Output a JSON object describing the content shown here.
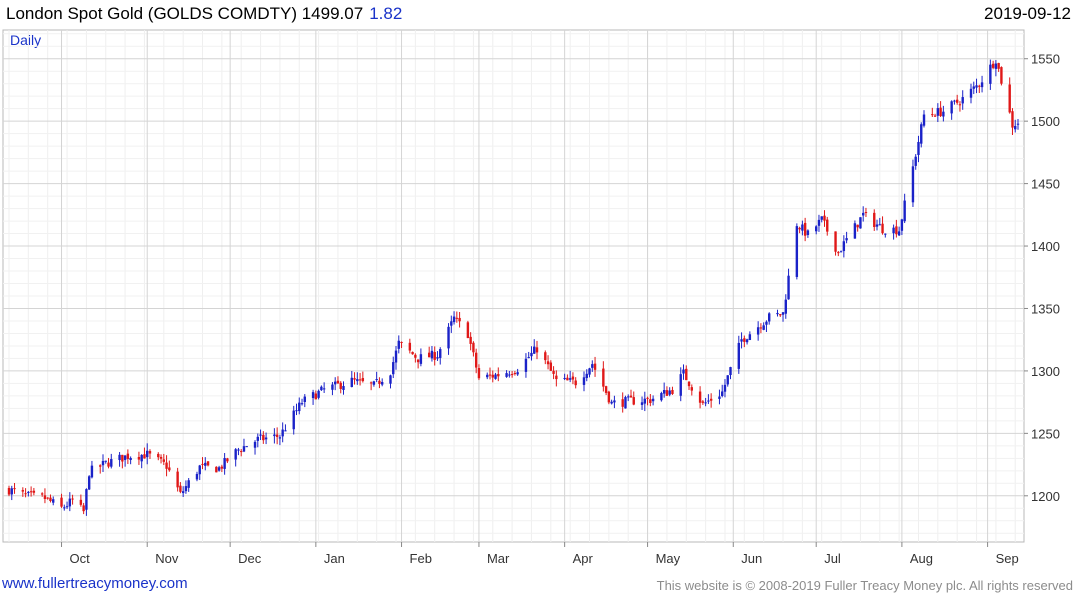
{
  "header": {
    "title": "London Spot Gold (GOLDS COMDTY) 1499.07",
    "change": "1.82",
    "date": "2019-09-12"
  },
  "footer": {
    "link": "www.fullertreacymoney.com",
    "copyright": "This website is © 2008-2019 Fuller Treacy Money plc. All rights reserved"
  },
  "chart_data": {
    "type": "candlestick",
    "period_label": "Daily",
    "y_ticks": [
      1200,
      1250,
      1300,
      1350,
      1400,
      1450,
      1500,
      1550
    ],
    "ylim": [
      1163,
      1573
    ],
    "x_ticks": [
      "Oct",
      "Nov",
      "Dec",
      "Jan",
      "Feb",
      "Mar",
      "Apr",
      "May",
      "Jun",
      "Jul",
      "Aug",
      "Sep"
    ],
    "x_tick_dates": [
      "2018-10-01",
      "2018-11-01",
      "2018-12-01",
      "2019-01-01",
      "2019-02-01",
      "2019-03-01",
      "2019-04-01",
      "2019-05-01",
      "2019-06-01",
      "2019-07-01",
      "2019-08-01",
      "2019-09-01"
    ],
    "date_range": [
      "2018-09-12",
      "2019-09-12"
    ],
    "colors": {
      "up": "#1a22c8",
      "down": "#e01818",
      "grid": "#dcdcdc"
    },
    "close_anchors": [
      [
        "2018-09-12",
        1205
      ],
      [
        "2018-09-18",
        1200
      ],
      [
        "2018-09-25",
        1198
      ],
      [
        "2018-10-01",
        1190
      ],
      [
        "2018-10-05",
        1196
      ],
      [
        "2018-10-09",
        1187
      ],
      [
        "2018-10-11",
        1219
      ],
      [
        "2018-10-17",
        1226
      ],
      [
        "2018-10-25",
        1232
      ],
      [
        "2018-11-01",
        1233
      ],
      [
        "2018-11-08",
        1224
      ],
      [
        "2018-11-13",
        1201
      ],
      [
        "2018-11-20",
        1223
      ],
      [
        "2018-11-27",
        1222
      ],
      [
        "2018-12-04",
        1237
      ],
      [
        "2018-12-11",
        1245
      ],
      [
        "2018-12-19",
        1248
      ],
      [
        "2018-12-27",
        1275
      ],
      [
        "2019-01-04",
        1285
      ],
      [
        "2019-01-14",
        1292
      ],
      [
        "2019-01-22",
        1288
      ],
      [
        "2019-01-28",
        1300
      ],
      [
        "2019-01-31",
        1322
      ],
      [
        "2019-02-07",
        1310
      ],
      [
        "2019-02-14",
        1313
      ],
      [
        "2019-02-20",
        1342
      ],
      [
        "2019-02-25",
        1330
      ],
      [
        "2019-03-01",
        1294
      ],
      [
        "2019-03-08",
        1297
      ],
      [
        "2019-03-15",
        1302
      ],
      [
        "2019-03-22",
        1318
      ],
      [
        "2019-03-29",
        1292
      ],
      [
        "2019-04-05",
        1291
      ],
      [
        "2019-04-11",
        1306
      ],
      [
        "2019-04-18",
        1274
      ],
      [
        "2019-04-25",
        1276
      ],
      [
        "2019-05-02",
        1277
      ],
      [
        "2019-05-10",
        1285
      ],
      [
        "2019-05-14",
        1298
      ],
      [
        "2019-05-21",
        1273
      ],
      [
        "2019-05-28",
        1283
      ],
      [
        "2019-06-04",
        1325
      ],
      [
        "2019-06-14",
        1343
      ],
      [
        "2019-06-19",
        1346
      ],
      [
        "2019-06-24",
        1418
      ],
      [
        "2019-06-28",
        1409
      ],
      [
        "2019-07-03",
        1421
      ],
      [
        "2019-07-09",
        1395
      ],
      [
        "2019-07-18",
        1425
      ],
      [
        "2019-07-25",
        1414
      ],
      [
        "2019-07-31",
        1413
      ],
      [
        "2019-08-05",
        1463
      ],
      [
        "2019-08-09",
        1505
      ],
      [
        "2019-08-16",
        1508
      ],
      [
        "2019-08-23",
        1518
      ],
      [
        "2019-08-29",
        1530
      ],
      [
        "2019-09-04",
        1550
      ],
      [
        "2019-09-10",
        1497
      ],
      [
        "2019-09-12",
        1499
      ]
    ]
  }
}
